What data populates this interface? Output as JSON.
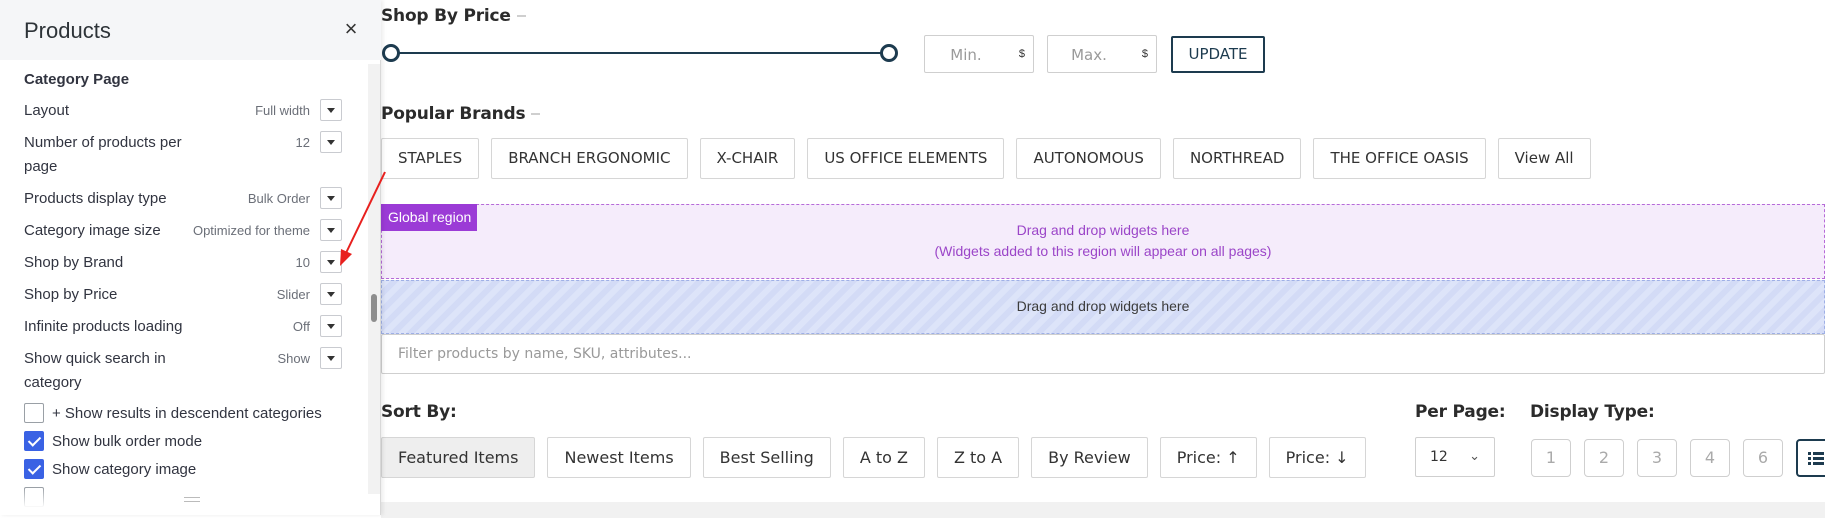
{
  "shop_by_price": {
    "title": "Shop By Price",
    "min_placeholder": "Min.",
    "max_placeholder": "Max.",
    "currency": "$",
    "update_label": "UPDATE"
  },
  "popular_brands": {
    "title": "Popular Brands",
    "brands": [
      "STAPLES",
      "BRANCH ERGONOMIC",
      "X-CHAIR",
      "US OFFICE ELEMENTS",
      "AUTONOMOUS",
      "NORTHREAD",
      "THE OFFICE OASIS",
      "View All"
    ]
  },
  "global_region": {
    "tag": "Global region",
    "line1": "Drag and drop widgets here",
    "line2": "(Widgets added to this region will appear on all pages)"
  },
  "drop_region": {
    "text": "Drag and drop widgets here"
  },
  "filter": {
    "placeholder": "Filter products by name, SKU, attributes..."
  },
  "sort": {
    "label": "Sort By:",
    "options": [
      "Featured Items",
      "Newest Items",
      "Best Selling",
      "A to Z",
      "Z to A",
      "By Review",
      "Price: ↑",
      "Price: ↓"
    ],
    "active_index": 0
  },
  "per_page": {
    "label": "Per Page:",
    "value": "12"
  },
  "display_type": {
    "label": "Display Type:",
    "options": [
      "1",
      "2",
      "3",
      "4",
      "6"
    ]
  },
  "panel": {
    "title": "Products",
    "close_glyph": "×",
    "group_title": "Category Page",
    "rows": [
      {
        "label": "Layout",
        "value": "Full width"
      },
      {
        "label": "Number of products per page",
        "value": "12"
      },
      {
        "label": "Products display type",
        "value": "Bulk Order"
      },
      {
        "label": "Category image size",
        "value": "Optimized for theme"
      },
      {
        "label": "Shop by Brand",
        "value": "10"
      },
      {
        "label": "Shop by Price",
        "value": "Slider"
      },
      {
        "label": "Infinite products loading",
        "value": "Off"
      },
      {
        "label": "Show quick search in category",
        "value": "Show"
      }
    ],
    "checkboxes": [
      {
        "label": "+ Show results in descendent categories",
        "checked": false
      },
      {
        "label": "Show bulk order mode",
        "checked": true
      },
      {
        "label": "Show category image",
        "checked": true
      }
    ]
  },
  "colors": {
    "accent": "#1d3b4f",
    "checkbox": "#3a62e4",
    "global_tag": "#9b3bd6",
    "annotation_arrow": "#e8201e"
  }
}
